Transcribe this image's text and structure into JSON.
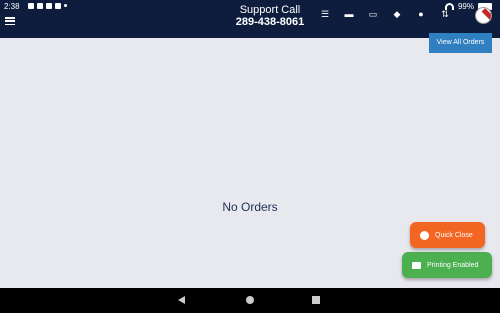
{
  "status_bar": {
    "time": "2:38",
    "battery": "99%"
  },
  "header": {
    "title": "Support Call",
    "phone": "289-438-8061",
    "icons": [
      "list-icon",
      "receipt-icon",
      "card-icon",
      "graduation-cap-icon",
      "clock-icon",
      "sort-icon"
    ]
  },
  "actions": {
    "view_all_orders": "View All Orders"
  },
  "main": {
    "empty_message": "No Orders"
  },
  "fabs": {
    "quick_close": "Quick Close",
    "printing_enabled": "Printing Enabled"
  },
  "colors": {
    "appbar": "#0e1d3d",
    "background": "#e8e8ef",
    "view_all_button": "#2f7fc1",
    "quick_close": "#f26523",
    "printing_enabled": "#4caf50"
  }
}
